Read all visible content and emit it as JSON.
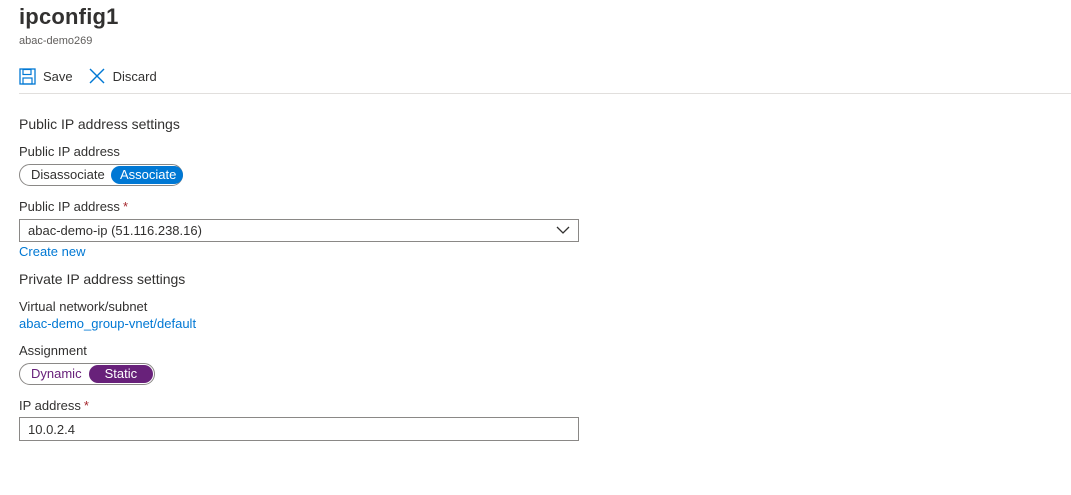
{
  "header": {
    "title": "ipconfig1",
    "subtitle": "abac-demo269"
  },
  "toolbar": {
    "save_label": "Save",
    "discard_label": "Discard"
  },
  "public_ip": {
    "section_title": "Public IP address settings",
    "toggle_label": "Public IP address",
    "options": [
      "Disassociate",
      "Associate"
    ],
    "selected": "Associate",
    "field_label": "Public IP address",
    "required_mark": "*",
    "dropdown_value": "abac-demo-ip (51.116.238.16)",
    "create_new": "Create new"
  },
  "private_ip": {
    "section_title": "Private IP address settings",
    "vnet_label": "Virtual network/subnet",
    "vnet_link": "abac-demo_group-vnet/default",
    "assignment_label": "Assignment",
    "options": [
      "Dynamic",
      "Static"
    ],
    "selected": "Static",
    "ip_label": "IP address",
    "required_mark": "*",
    "ip_value": "10.0.2.4"
  },
  "colors": {
    "accent": "#0078d4",
    "static_selected": "#68217a",
    "required": "#a4262c"
  },
  "icons": {
    "save": "save-icon",
    "discard": "close-icon",
    "dropdown": "chevron-down-icon"
  }
}
